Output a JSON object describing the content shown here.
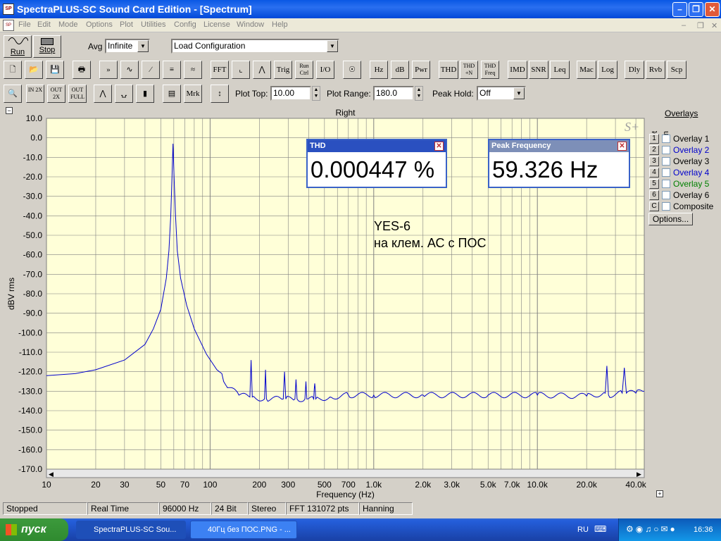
{
  "window": {
    "title": "SpectraPLUS-SC Sound Card Edition - [Spectrum]"
  },
  "menu": [
    "File",
    "Edit",
    "Mode",
    "Options",
    "Plot",
    "Utilities",
    "Config",
    "License",
    "Window",
    "Help"
  ],
  "run": {
    "run_label": "Run",
    "stop_label": "Stop"
  },
  "avg": {
    "label": "Avg",
    "value": "Infinite"
  },
  "config": {
    "value": "Load Configuration"
  },
  "toolbar2": [
    "FFT",
    "Trig",
    "Run Ctrl",
    "I/O",
    "Hz",
    "dB",
    "Pwr",
    "THD",
    "THD +N",
    "THD Freq",
    "IMD",
    "SNR",
    "Leq",
    "Mac",
    "Log",
    "Dly",
    "Rvb",
    "Scp"
  ],
  "toolbar3": {
    "mrk": "Mrk",
    "plot_top_label": "Plot Top:",
    "plot_top_value": "10.00",
    "plot_range_label": "Plot Range:",
    "plot_range_value": "180.0",
    "peak_hold_label": "Peak Hold:",
    "peak_hold_value": "Off"
  },
  "chart_data": {
    "type": "line",
    "title": "Right",
    "xlabel": "Frequency (Hz)",
    "ylabel": "dBV rms",
    "xscale": "log",
    "xlim": [
      10,
      45000
    ],
    "ylim": [
      -170,
      10
    ],
    "yticks": [
      "10.0",
      "0.0",
      "-10.0",
      "-20.0",
      "-30.0",
      "-40.0",
      "-50.0",
      "-60.0",
      "-70.0",
      "-80.0",
      "-90.0",
      "-100.0",
      "-110.0",
      "-120.0",
      "-130.0",
      "-140.0",
      "-150.0",
      "-160.0",
      "-170.0"
    ],
    "xticks": [
      {
        "v": 10,
        "t": "10"
      },
      {
        "v": 20,
        "t": "20"
      },
      {
        "v": 30,
        "t": "30"
      },
      {
        "v": 50,
        "t": "50"
      },
      {
        "v": 70,
        "t": "70"
      },
      {
        "v": 100,
        "t": "100"
      },
      {
        "v": 200,
        "t": "200"
      },
      {
        "v": 300,
        "t": "300"
      },
      {
        "v": 500,
        "t": "500"
      },
      {
        "v": 700,
        "t": "700"
      },
      {
        "v": 1000,
        "t": "1.0k"
      },
      {
        "v": 2000,
        "t": "2.0k"
      },
      {
        "v": 3000,
        "t": "3.0k"
      },
      {
        "v": 5000,
        "t": "5.0k"
      },
      {
        "v": 7000,
        "t": "7.0k"
      },
      {
        "v": 10000,
        "t": "10.0k"
      },
      {
        "v": 20000,
        "t": "20.0k"
      },
      {
        "v": 40000,
        "t": "40.0k"
      }
    ],
    "series": [
      {
        "color": "#0000cc",
        "points": [
          [
            10,
            -122
          ],
          [
            15,
            -121
          ],
          [
            20,
            -119
          ],
          [
            30,
            -114
          ],
          [
            40,
            -106
          ],
          [
            45,
            -98
          ],
          [
            50,
            -88
          ],
          [
            54,
            -72
          ],
          [
            56,
            -58
          ],
          [
            57.5,
            -40
          ],
          [
            58.5,
            -20
          ],
          [
            59.326,
            -3
          ],
          [
            60.2,
            -20
          ],
          [
            61.5,
            -40
          ],
          [
            63,
            -58
          ],
          [
            66,
            -72
          ],
          [
            72,
            -86
          ],
          [
            80,
            -98
          ],
          [
            95,
            -111
          ],
          [
            110,
            -119
          ],
          [
            118,
            -121
          ],
          [
            121,
            -125
          ],
          [
            125,
            -127
          ],
          [
            150,
            -132
          ],
          [
            175,
            -133
          ],
          [
            178,
            -114
          ],
          [
            181,
            -133
          ],
          [
            215,
            -134
          ],
          [
            218,
            -119
          ],
          [
            221,
            -134
          ],
          [
            280,
            -134
          ],
          [
            285,
            -120
          ],
          [
            290,
            -134
          ],
          [
            330,
            -134
          ],
          [
            335,
            -124
          ],
          [
            340,
            -134
          ],
          [
            380,
            -134
          ],
          [
            385,
            -125
          ],
          [
            390,
            -134
          ],
          [
            430,
            -134
          ],
          [
            436,
            -126
          ],
          [
            442,
            -134
          ],
          [
            540,
            -133
          ],
          [
            700,
            -132
          ],
          [
            1000,
            -132
          ],
          [
            2000,
            -132
          ],
          [
            5000,
            -132
          ],
          [
            10000,
            -132
          ],
          [
            20000,
            -132.5
          ],
          [
            26000,
            -131
          ],
          [
            26600,
            -117
          ],
          [
            27200,
            -132
          ],
          [
            33000,
            -131
          ],
          [
            34000,
            -118
          ],
          [
            35000,
            -131
          ],
          [
            40000,
            -131
          ],
          [
            45000,
            -130
          ]
        ]
      }
    ]
  },
  "thd": {
    "title": "THD",
    "value": "0.000447 %"
  },
  "peak": {
    "title": "Peak Frequency",
    "value": "59.326 Hz"
  },
  "annotation": {
    "line1": "YES-6",
    "line2": "на клем. АС с ПОС"
  },
  "overlays": {
    "title": "Overlays",
    "set_label": "Set",
    "on_label": "On",
    "items": [
      {
        "num": "1",
        "label": "Overlay 1",
        "color": "#000000"
      },
      {
        "num": "2",
        "label": "Overlay 2",
        "color": "#0000cc"
      },
      {
        "num": "3",
        "label": "Overlay 3",
        "color": "#000000"
      },
      {
        "num": "4",
        "label": "Overlay 4",
        "color": "#0000cc"
      },
      {
        "num": "5",
        "label": "Overlay 5",
        "color": "#008000"
      },
      {
        "num": "6",
        "label": "Overlay 6",
        "color": "#000000"
      },
      {
        "num": "C",
        "label": "Composite",
        "color": "#000000"
      }
    ],
    "options_label": "Options..."
  },
  "status": [
    "Stopped",
    "Real Time",
    "96000 Hz",
    "24 Bit",
    "Stereo",
    "FFT 131072 pts",
    "Hanning"
  ],
  "taskbar": {
    "start": "пуск",
    "tasks": [
      "SpectraPLUS-SC Sou...",
      "40Гц без ПОС.PNG - ..."
    ],
    "lang": "RU",
    "clock": "16:36"
  }
}
